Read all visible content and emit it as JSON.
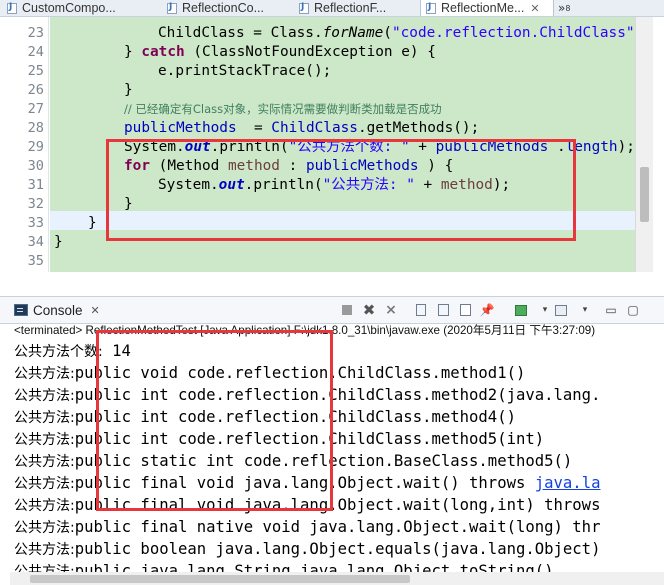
{
  "editor_tabs": [
    {
      "label": "CustomCompo...",
      "active": false
    },
    {
      "label": "ReflectionCo...",
      "active": false
    },
    {
      "label": "ReflectionF...",
      "active": false
    },
    {
      "label": "ReflectionMe...",
      "active": true
    }
  ],
  "tab_overflow": {
    "label": "»",
    "count": "8"
  },
  "code_lines": [
    {
      "num": "23",
      "parts": [
        [
          "plain",
          "    ChildClass = Class."
        ],
        [
          "smth",
          "forName"
        ],
        [
          "plain",
          "("
        ],
        [
          "str",
          "\"code.reflection.ChildClass\""
        ],
        [
          "plain",
          ");"
        ]
      ]
    },
    {
      "num": "24",
      "parts": [
        [
          "plain",
          "  } "
        ],
        [
          "kw",
          "catch"
        ],
        [
          "plain",
          " (ClassNotFoundException e) {"
        ]
      ]
    },
    {
      "num": "25",
      "parts": [
        [
          "plain",
          "    e.printStackTrace();"
        ]
      ]
    },
    {
      "num": "26",
      "parts": [
        [
          "plain",
          "  }"
        ]
      ]
    },
    {
      "num": "27",
      "parts": [
        [
          "plain",
          "  "
        ],
        [
          "cmt",
          "// 已经确定有Class对象，实际情况需要做判断类加载是否成功"
        ]
      ]
    },
    {
      "num": "28",
      "parts": [
        [
          "plain",
          "  "
        ],
        [
          "fld",
          "publicMethods"
        ],
        [
          "plain",
          "  = "
        ],
        [
          "fld",
          "ChildClass"
        ],
        [
          "plain",
          ".getMethods();"
        ]
      ]
    },
    {
      "num": "29",
      "parts": [
        [
          "plain",
          "  System."
        ],
        [
          "sfld",
          "out"
        ],
        [
          "plain",
          ".println("
        ],
        [
          "str",
          "\"公共方法个数: \""
        ],
        [
          "plain",
          " + "
        ],
        [
          "fld",
          "publicMethods"
        ],
        [
          "plain",
          " ."
        ],
        [
          "fld",
          "length"
        ],
        [
          "plain",
          ");"
        ]
      ]
    },
    {
      "num": "30",
      "parts": [
        [
          "plain",
          "  "
        ],
        [
          "kw",
          "for"
        ],
        [
          "plain",
          " (Method "
        ],
        [
          "var",
          "method"
        ],
        [
          "plain",
          " : "
        ],
        [
          "fld",
          "publicMethods"
        ],
        [
          "plain",
          " ) {"
        ]
      ]
    },
    {
      "num": "31",
      "parts": [
        [
          "plain",
          "    System."
        ],
        [
          "sfld",
          "out"
        ],
        [
          "plain",
          ".println("
        ],
        [
          "str",
          "\"公共方法: \""
        ],
        [
          "plain",
          " + "
        ],
        [
          "var",
          "method"
        ],
        [
          "plain",
          ");"
        ]
      ]
    },
    {
      "num": "32",
      "parts": [
        [
          "plain",
          "  }"
        ]
      ]
    },
    {
      "num": "33",
      "parts": [
        [
          "plain",
          " }"
        ]
      ]
    },
    {
      "num": "34",
      "parts": [
        [
          "plain",
          "}"
        ]
      ]
    },
    {
      "num": "35",
      "parts": []
    }
  ],
  "console": {
    "tab_label": "Console",
    "terminated_line": "<terminated> ReflectionMethodTest [Java Application] F:\\jdk1.8.0_31\\bin\\javaw.exe (2020年5月11日 下午3:27:09)",
    "output": [
      {
        "prefix": "公共方法个数:",
        "text": " 14",
        "link": ""
      },
      {
        "prefix": "公共方法:",
        "text": "public void code.reflection.ChildClass.method1()",
        "link": ""
      },
      {
        "prefix": "公共方法:",
        "text": "public int code.reflection.ChildClass.method2(java.lang.",
        "link": ""
      },
      {
        "prefix": "公共方法:",
        "text": "public int code.reflection.ChildClass.method4()",
        "link": ""
      },
      {
        "prefix": "公共方法:",
        "text": "public int code.reflection.ChildClass.method5(int)",
        "link": ""
      },
      {
        "prefix": "公共方法:",
        "text": "public static int code.reflection.BaseClass.method5()",
        "link": ""
      },
      {
        "prefix": "公共方法:",
        "text": "public final void java.lang.Object.wait() throws ",
        "link": "java.la"
      },
      {
        "prefix": "公共方法:",
        "text": "public final void java.lang.Object.wait(long,int) throws",
        "link": ""
      },
      {
        "prefix": "公共方法:",
        "text": "public final native void java.lang.Object.wait(long) thr",
        "link": ""
      },
      {
        "prefix": "公共方法:",
        "text": "public boolean java.lang.Object.equals(java.lang.Object)",
        "link": ""
      },
      {
        "prefix": "公共方法:",
        "text": "public java.lang.String java.lang.Object.toString()",
        "link": ""
      }
    ]
  },
  "toolbar_icons": [
    "stop-icon",
    "remove-launch-icon",
    "remove-all-icon",
    "scroll-lock-icon",
    "word-wrap-icon",
    "clear-console-icon",
    "pin-console-icon",
    "display-selected-icon",
    "new-console-icon",
    "minimize-icon",
    "maximize-icon"
  ],
  "colors": {
    "code_bg": "#cde8c8",
    "highlight_box": "#e8363d",
    "keyword": "#7f0055",
    "string": "#2a00ff",
    "field": "#0000c0",
    "comment": "#3f7f5f"
  }
}
